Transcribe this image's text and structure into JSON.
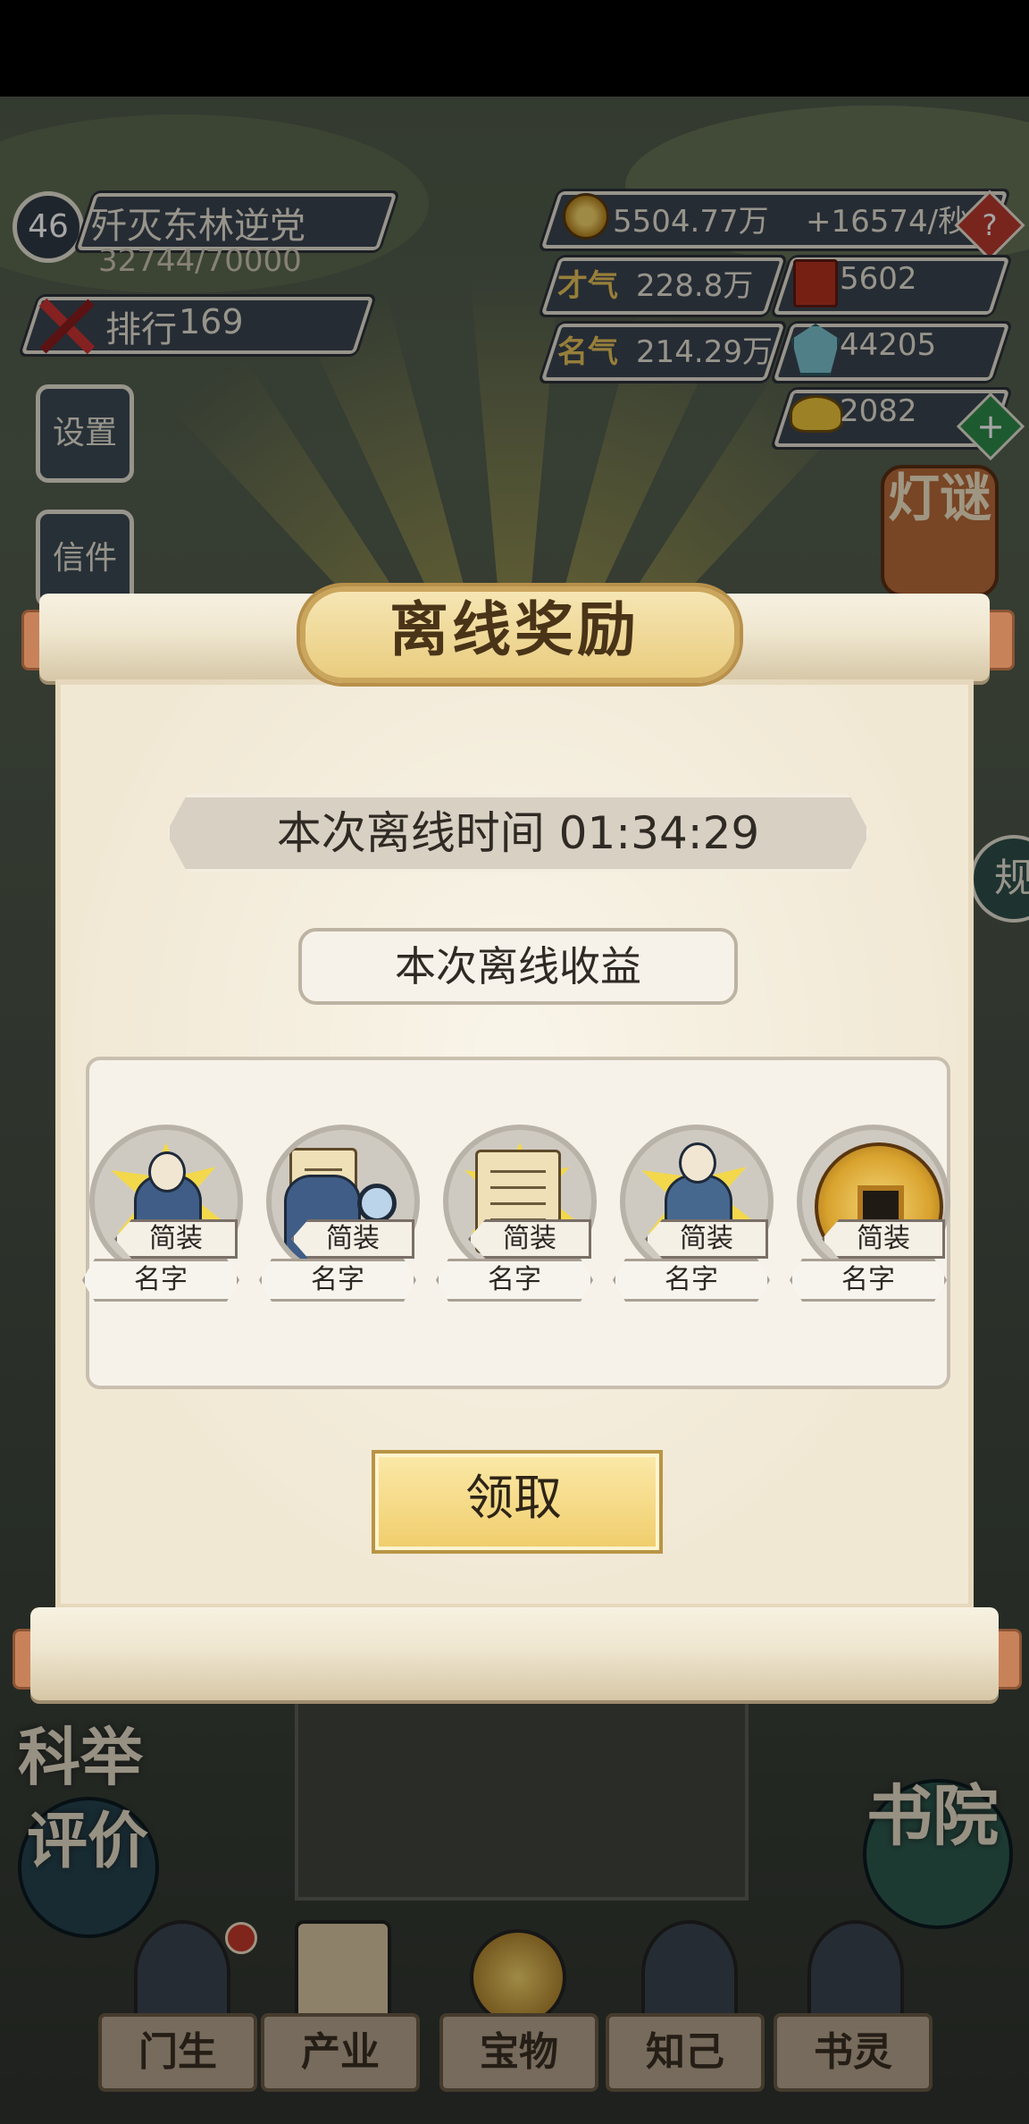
{
  "hud": {
    "level": "46",
    "title": "歼灭东林逆党",
    "exp": "32744/70000",
    "rank_label": "排行",
    "rank_value": "169",
    "copper": "5504.77万",
    "copper_rate": "+16574/秒",
    "talent_label": "才气",
    "talent": "228.8万",
    "books": "5602",
    "fame_label": "名气",
    "fame": "214.29万",
    "jade": "44205",
    "gold_ingot": "2082"
  },
  "side_left": {
    "settings": "设置",
    "mail": "信件"
  },
  "side_right": {
    "lantern": "灯谜",
    "rules": "规"
  },
  "background_labels": {
    "keju": "科举",
    "review": "评价",
    "academy": "书院"
  },
  "dock": {
    "students": "门生",
    "industry": "产业",
    "treasure": "宝物",
    "confidants": "知己",
    "bookboy": "书灵"
  },
  "modal": {
    "title": "离线奖励",
    "offline_time": "本次离线时间 01:34:29",
    "income_label": "本次离线收益",
    "items": [
      {
        "tag": "简装",
        "name": "名字",
        "icon": "scholar-reading-icon"
      },
      {
        "tag": "简装",
        "name": "名字",
        "icon": "scholar-magnifier-icon"
      },
      {
        "tag": "简装",
        "name": "名字",
        "icon": "scroll-document-icon"
      },
      {
        "tag": "简装",
        "name": "名字",
        "icon": "scholar-reading-book-icon"
      },
      {
        "tag": "简装",
        "name": "名字",
        "icon": "copper-coin-icon"
      }
    ],
    "claim_label": "领取"
  }
}
